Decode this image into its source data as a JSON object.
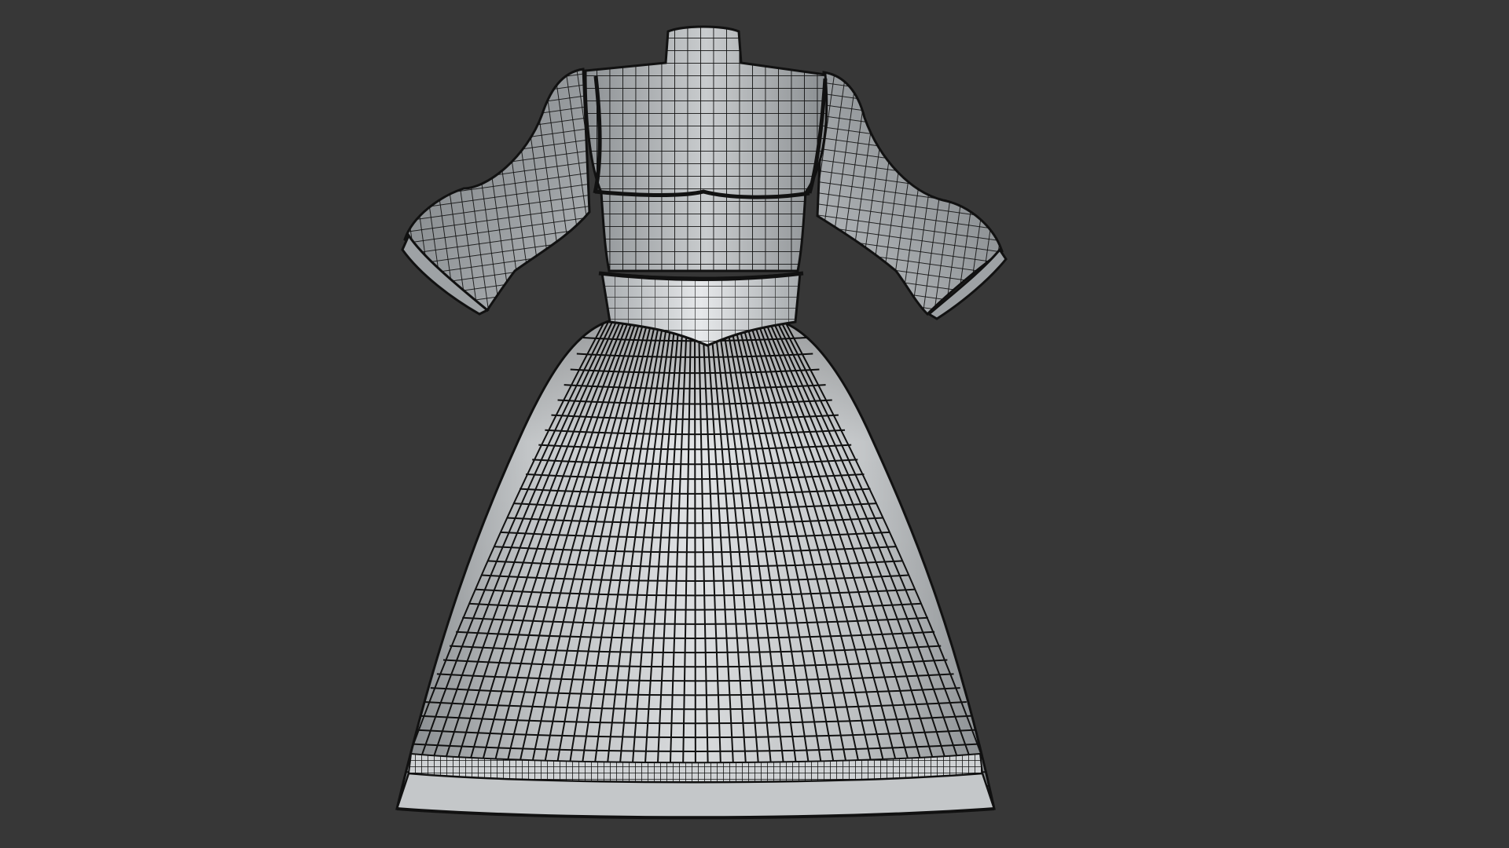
{
  "scene": {
    "subject": "dress-wireframe-back-view",
    "colors": {
      "background": "#373737",
      "cloth_light": "#d9dcde",
      "cloth_mid": "#a7abae",
      "cloth_dark": "#75797c",
      "wire": "#101010",
      "trim": "#1b1b1b"
    }
  }
}
